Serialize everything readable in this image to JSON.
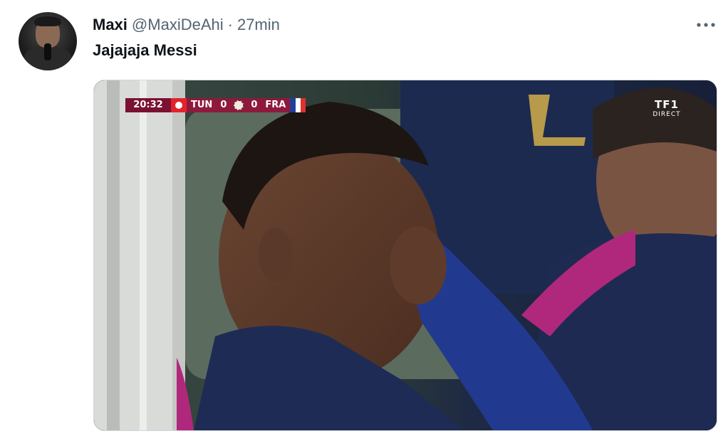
{
  "tweet": {
    "author_name": "Maxi",
    "handle": "@MaxiDeAhi",
    "separator": "·",
    "time": "27min",
    "text": "Jajajaja Messi",
    "more_icon": "more-icon"
  },
  "scoreboard": {
    "clock": "20:32",
    "home_team": "TUN",
    "home_score": "0",
    "away_score": "0",
    "away_team": "FRA"
  },
  "broadcast_logo": {
    "main": "TF1",
    "sub": "DIRECT"
  },
  "colors": {
    "text_primary": "#0f1419",
    "text_secondary": "#536471",
    "scorebug": "#8d1a3c"
  }
}
